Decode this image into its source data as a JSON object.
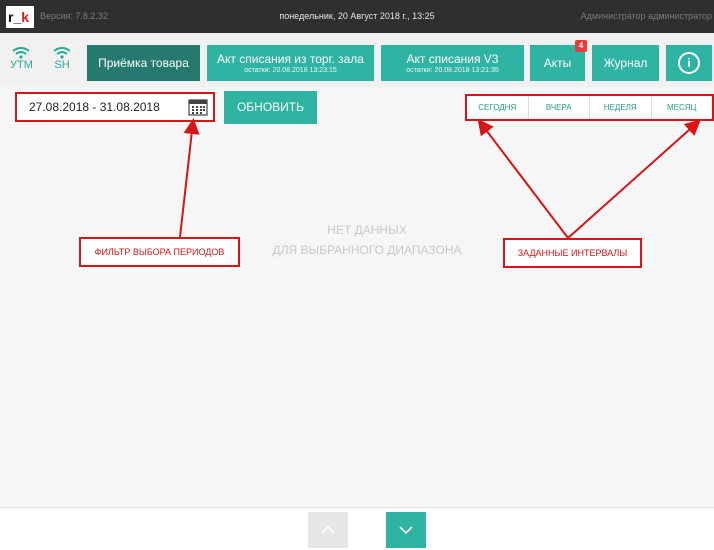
{
  "topbar": {
    "logo_main": "r_",
    "logo_accent": "k",
    "version": "Версия: 7.8.2.32",
    "datetime": "понедельник, 20 Август 2018 г., 13:25",
    "admin": "Администратор администратор"
  },
  "status": {
    "utm_label": "УТМ",
    "sh_label": "SH",
    "accent_color": "#2fb3a3"
  },
  "toolbar": {
    "receive_label": "Приёмка товара",
    "writeoff_hall_label": "Акт списания из торг. зала",
    "writeoff_hall_sub": "остатки: 20.08.2018 13:23:15",
    "writeoff_v3_label": "Акт списания V3",
    "writeoff_v3_sub": "остатки: 20.08.2018 13:21:35",
    "acts_label": "Акты",
    "acts_badge": "4",
    "journal_label": "Журнал",
    "info_symbol": "i"
  },
  "filter": {
    "date_range": "27.08.2018 - 31.08.2018",
    "refresh_label": "ОБНОВИТЬ"
  },
  "intervals": [
    "СЕГОДНЯ",
    "ВЧЕРА",
    "НЕДЕЛЯ",
    "МЕСЯЦ"
  ],
  "empty_state": {
    "line1": "НЕТ ДАННЫХ",
    "line2": "ДЛЯ ВЫБРАННОГО ДИАПАЗОНА"
  },
  "annotations": {
    "filter_label": "ФИЛЬТР ВЫБОРА ПЕРИОДОВ",
    "intervals_label": "ЗАДАННЫЕ ИНТЕРВАЛЫ",
    "color": "#d81414"
  },
  "navigation": {
    "up_icon": "chevron-up-icon",
    "down_icon": "chevron-down-icon"
  }
}
